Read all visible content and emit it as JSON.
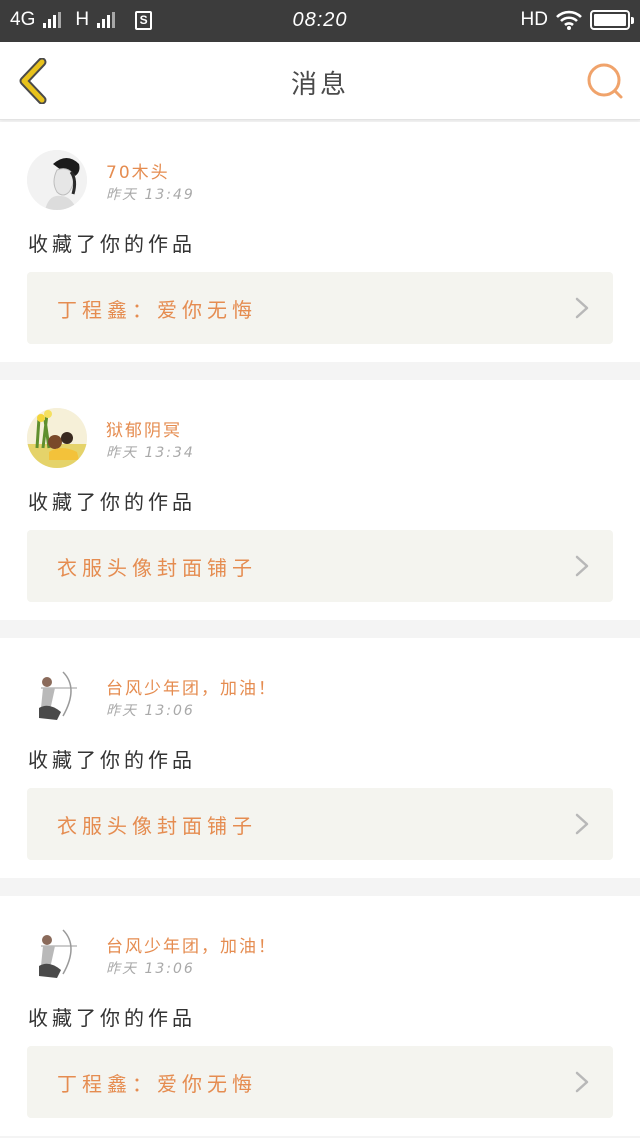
{
  "status_bar": {
    "network": "4G",
    "network2": "H",
    "sim_icon": "S",
    "time": "08:20",
    "hd": "HD",
    "icons": [
      "signal-icon",
      "signal-icon",
      "sim-icon",
      "wifi-icon",
      "battery-icon"
    ]
  },
  "header": {
    "title": "消息",
    "back_icon": "chevron-left-icon",
    "search_icon": "search-icon"
  },
  "colors": {
    "accent": "#e58c50",
    "back_icon": "#e8c21c",
    "search_icon": "#f0a36b"
  },
  "messages": [
    {
      "user": "70木头",
      "time": "昨天 13:49",
      "action": "收藏了你的作品",
      "work": "丁程鑫：爱你无悔",
      "avatar": "avatar-portrait-bw"
    },
    {
      "user": "狱郁阴冥",
      "time": "昨天 13:34",
      "action": "收藏了你的作品",
      "work": "衣服头像封面铺子",
      "avatar": "avatar-flowers"
    },
    {
      "user": "台风少年团，加油！",
      "time": "昨天 13:06",
      "action": "收藏了你的作品",
      "work": "衣服头像封面铺子",
      "avatar": "avatar-archer-sketch"
    },
    {
      "user": "台风少年团，加油！",
      "time": "昨天 13:06",
      "action": "收藏了你的作品",
      "work": "丁程鑫：爱你无悔",
      "avatar": "avatar-archer-sketch"
    }
  ]
}
